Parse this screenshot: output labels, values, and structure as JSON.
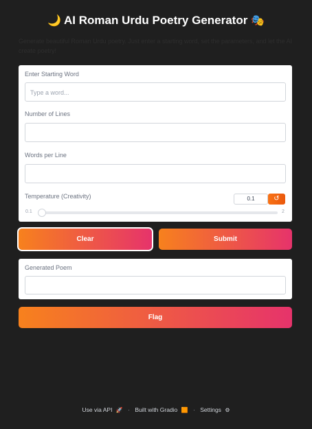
{
  "header": {
    "title_icon_left": "🌙",
    "title": "AI Roman Urdu Poetry Generator",
    "title_icon_right": "🎭",
    "description": "Generate beautiful Roman Urdu poetry. Just enter a starting word, set the parameters, and let the AI create poetry!"
  },
  "form": {
    "start_word": {
      "label": "Enter Starting Word",
      "placeholder": "Type a word...",
      "value": ""
    },
    "num_lines": {
      "label": "Number of Lines",
      "value": ""
    },
    "words_per_line": {
      "label": "Words per Line",
      "value": ""
    },
    "temperature": {
      "label": "Temperature (Creativity)",
      "value": "0.1",
      "min": "0.1",
      "max": "2",
      "fraction": 0.0,
      "reset_icon": "reset-icon"
    }
  },
  "buttons": {
    "clear": "Clear",
    "submit": "Submit",
    "flag": "Flag"
  },
  "output": {
    "label": "Generated Poem",
    "value": ""
  },
  "footer": {
    "api": "Use via API",
    "api_icon": "🚀",
    "built": "Built with Gradio",
    "built_icon": "🟧",
    "settings": "Settings",
    "settings_icon": "⚙"
  },
  "colors": {
    "accent_start": "#f7811d",
    "accent_end": "#e6336b",
    "background": "#1f1f1f"
  }
}
